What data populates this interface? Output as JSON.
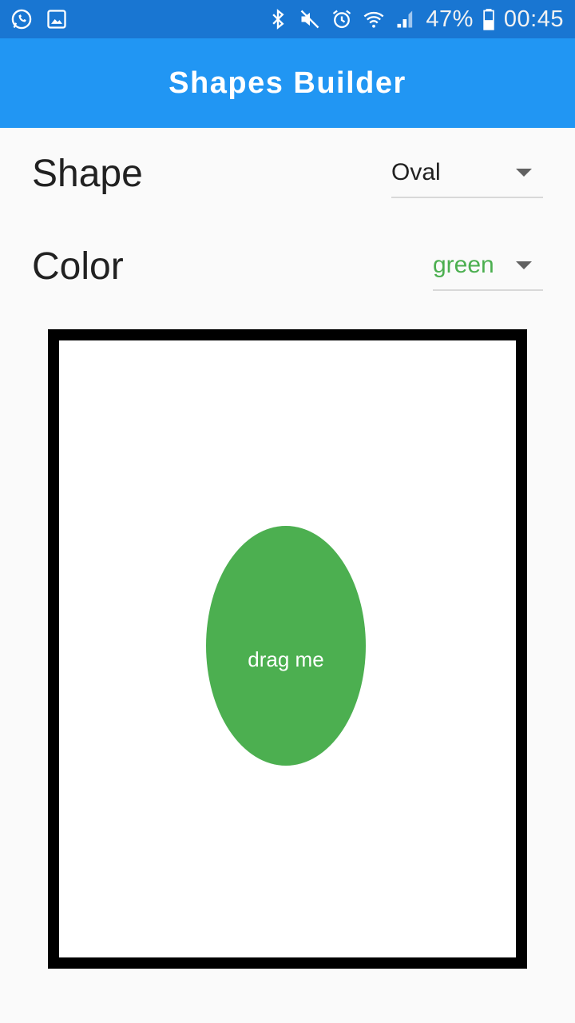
{
  "status_bar": {
    "left_icons": [
      "whatsapp-icon",
      "gallery-icon"
    ],
    "right_icons": [
      "bluetooth-icon",
      "mute-icon",
      "alarm-icon",
      "wifi-icon",
      "signal-icon"
    ],
    "battery_percent": "47%",
    "time": "00:45"
  },
  "app_bar": {
    "title": "Shapes Builder",
    "color": "#2196f3"
  },
  "shape_row": {
    "label": "Shape",
    "selected": "Oval"
  },
  "color_row": {
    "label": "Color",
    "selected": "green",
    "selected_color": "#4caf50"
  },
  "canvas": {
    "shape": "oval",
    "shape_color": "#4caf50",
    "shape_label": "drag me"
  }
}
